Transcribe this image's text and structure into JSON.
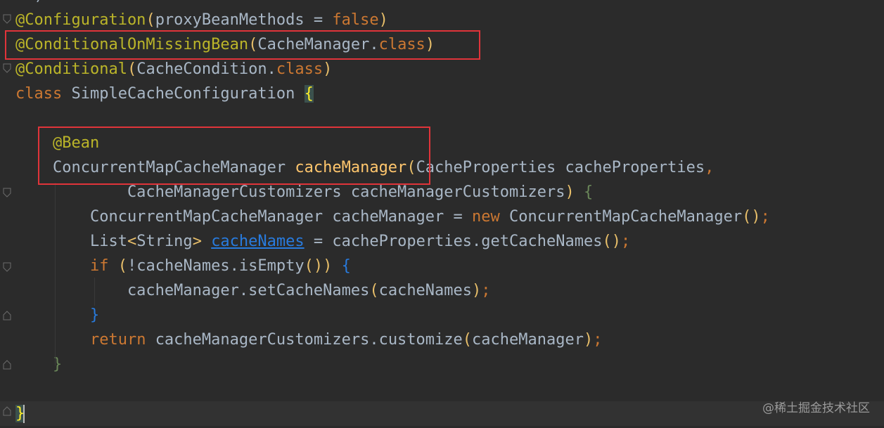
{
  "editor": {
    "colors": {
      "background": "#2b2b2b",
      "annotation": "#bbb529",
      "keyword": "#cc7832",
      "text": "#a9b7c6",
      "method": "#ffc66d",
      "field": "#9876aa",
      "link": "#287bde",
      "brace_match": "#3b514d",
      "highlight_box": "#e0343a"
    },
    "lines": [
      {
        "name": "line-configuration",
        "tokens": [
          {
            "t": "@Configuration",
            "c": "annotation"
          },
          {
            "t": "(",
            "c": "paren"
          },
          {
            "t": "proxyBeanMethods = ",
            "c": "text"
          },
          {
            "t": "false",
            "c": "keyword"
          },
          {
            "t": ")",
            "c": "paren"
          }
        ]
      },
      {
        "name": "line-conditional-on-missing-bean",
        "tokens": [
          {
            "t": "@ConditionalOnMissingBean",
            "c": "annotation"
          },
          {
            "t": "(",
            "c": "paren"
          },
          {
            "t": "CacheManager.",
            "c": "text"
          },
          {
            "t": "class",
            "c": "keyword"
          },
          {
            "t": ")",
            "c": "paren"
          }
        ]
      },
      {
        "name": "line-conditional",
        "tokens": [
          {
            "t": "@Conditional",
            "c": "annotation"
          },
          {
            "t": "(",
            "c": "paren"
          },
          {
            "t": "CacheCondition.",
            "c": "text"
          },
          {
            "t": "class",
            "c": "keyword"
          },
          {
            "t": ")",
            "c": "paren"
          }
        ]
      },
      {
        "name": "line-class-declaration",
        "tokens": [
          {
            "t": "class ",
            "c": "keyword"
          },
          {
            "t": "SimpleCacheConfiguration ",
            "c": "text"
          },
          {
            "t": "{",
            "c": "brace-match"
          }
        ]
      },
      {
        "name": "line-blank",
        "tokens": []
      },
      {
        "name": "line-bean-annotation",
        "tokens": [
          {
            "t": "    ",
            "c": "text"
          },
          {
            "t": "@Bean",
            "c": "annotation"
          }
        ]
      },
      {
        "name": "line-method-signature",
        "tokens": [
          {
            "t": "    ConcurrentMapCacheManager ",
            "c": "text"
          },
          {
            "t": "cacheManager",
            "c": "method"
          },
          {
            "t": "(",
            "c": "paren"
          },
          {
            "t": "CacheProperties cacheProperties",
            "c": "text"
          },
          {
            "t": ",",
            "c": "keyword"
          }
        ]
      },
      {
        "name": "line-method-signature-cont",
        "tokens": [
          {
            "t": "            CacheManagerCustomizers cacheManagerCustomizers",
            "c": "text"
          },
          {
            "t": ") ",
            "c": "paren"
          },
          {
            "t": "{",
            "c": "brace-green"
          }
        ]
      },
      {
        "name": "line-new-cache-manager",
        "tokens": [
          {
            "t": "        ConcurrentMapCacheManager cacheManager = ",
            "c": "text"
          },
          {
            "t": "new ",
            "c": "keyword"
          },
          {
            "t": "ConcurrentMapCacheManager",
            "c": "text"
          },
          {
            "t": "()",
            "c": "paren"
          },
          {
            "t": ";",
            "c": "keyword"
          }
        ]
      },
      {
        "name": "line-cache-names",
        "tokens": [
          {
            "t": "        List",
            "c": "text"
          },
          {
            "t": "<",
            "c": "generic"
          },
          {
            "t": "String",
            "c": "text"
          },
          {
            "t": "> ",
            "c": "generic"
          },
          {
            "t": "cacheNames",
            "c": "link"
          },
          {
            "t": " = cacheProperties.getCacheNames",
            "c": "text"
          },
          {
            "t": "()",
            "c": "paren"
          },
          {
            "t": ";",
            "c": "keyword"
          }
        ]
      },
      {
        "name": "line-if",
        "tokens": [
          {
            "t": "        ",
            "c": "text"
          },
          {
            "t": "if ",
            "c": "keyword"
          },
          {
            "t": "(",
            "c": "paren"
          },
          {
            "t": "!cacheNames.isEmpty",
            "c": "text"
          },
          {
            "t": "()",
            "c": "paren"
          },
          {
            "t": ") ",
            "c": "paren"
          },
          {
            "t": "{",
            "c": "brace-blue"
          }
        ]
      },
      {
        "name": "line-set-cache-names",
        "tokens": [
          {
            "t": "            cacheManager.setCacheNames",
            "c": "text"
          },
          {
            "t": "(",
            "c": "paren"
          },
          {
            "t": "cacheNames",
            "c": "text"
          },
          {
            "t": ")",
            "c": "paren"
          },
          {
            "t": ";",
            "c": "keyword"
          }
        ]
      },
      {
        "name": "line-if-close",
        "tokens": [
          {
            "t": "        ",
            "c": "text"
          },
          {
            "t": "}",
            "c": "brace-blue"
          }
        ]
      },
      {
        "name": "line-return",
        "tokens": [
          {
            "t": "        ",
            "c": "text"
          },
          {
            "t": "return ",
            "c": "keyword"
          },
          {
            "t": "cacheManagerCustomizers.customize",
            "c": "text"
          },
          {
            "t": "(",
            "c": "paren"
          },
          {
            "t": "cacheManager",
            "c": "text"
          },
          {
            "t": ")",
            "c": "paren"
          },
          {
            "t": ";",
            "c": "keyword"
          }
        ]
      },
      {
        "name": "line-method-close",
        "tokens": [
          {
            "t": "    ",
            "c": "text"
          },
          {
            "t": "}",
            "c": "brace-green"
          }
        ]
      },
      {
        "name": "line-blank-2",
        "tokens": []
      },
      {
        "name": "line-class-close",
        "tokens": [
          {
            "t": "}",
            "c": "brace-match"
          }
        ]
      }
    ]
  },
  "watermark": "@稀土掘金技术社区"
}
